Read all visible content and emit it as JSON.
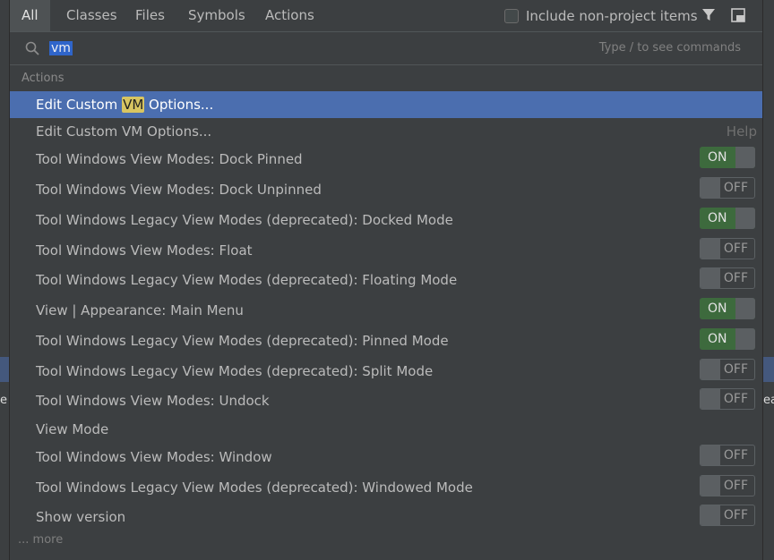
{
  "background": {
    "edge_left": "e",
    "edge_right": "ea"
  },
  "tabs": [
    {
      "label": "All",
      "active": true
    },
    {
      "label": "Classes",
      "active": false
    },
    {
      "label": "Files",
      "active": false
    },
    {
      "label": "Symbols",
      "active": false
    },
    {
      "label": "Actions",
      "active": false
    }
  ],
  "header": {
    "include_label": "Include non-project items",
    "include_checked": false,
    "filter_icon": "filter-icon",
    "pin_icon": "pin-window-icon"
  },
  "search": {
    "icon": "search-icon",
    "value": "vm",
    "hint": "Type / to see commands"
  },
  "group_title": "Actions",
  "rows": [
    {
      "pre": "Edit Custom ",
      "match": "VM",
      "post": " Options...",
      "selected": true
    },
    {
      "label": "Edit Custom VM Options...",
      "right": "Help"
    },
    {
      "label": "Tool Windows View Modes: Dock Pinned",
      "toggle": "ON"
    },
    {
      "label": "Tool Windows View Modes: Dock Unpinned",
      "toggle": "OFF"
    },
    {
      "label": "Tool Windows Legacy View Modes (deprecated): Docked Mode",
      "toggle": "ON"
    },
    {
      "label": "Tool Windows View Modes: Float",
      "toggle": "OFF"
    },
    {
      "label": "Tool Windows Legacy View Modes (deprecated): Floating Mode",
      "toggle": "OFF"
    },
    {
      "label": "View | Appearance: Main Menu",
      "toggle": "ON"
    },
    {
      "label": "Tool Windows Legacy View Modes (deprecated): Pinned Mode",
      "toggle": "ON"
    },
    {
      "label": "Tool Windows Legacy View Modes (deprecated): Split Mode",
      "toggle": "OFF"
    },
    {
      "label": "Tool Windows View Modes: Undock",
      "toggle": "OFF"
    },
    {
      "label": "View Mode"
    },
    {
      "label": "Tool Windows View Modes: Window",
      "toggle": "OFF"
    },
    {
      "label": "Tool Windows Legacy View Modes (deprecated): Windowed Mode",
      "toggle": "OFF"
    },
    {
      "label": "Show version",
      "toggle": "OFF"
    }
  ],
  "more_label": "... more",
  "colors": {
    "selection": "#4b6eaf",
    "match_highlight": "#d8c561",
    "toggle_on": "#3d6a3d"
  }
}
